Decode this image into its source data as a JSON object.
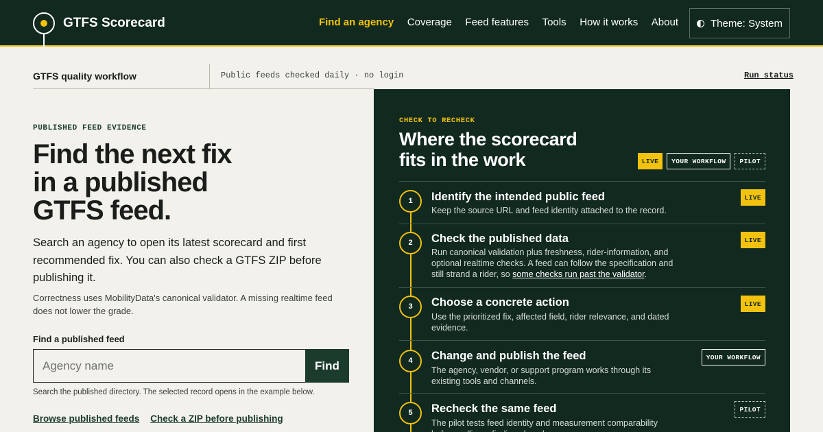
{
  "header": {
    "brand": "GTFS Scorecard",
    "nav": [
      "Find an agency",
      "Coverage",
      "Feed features",
      "Tools",
      "How it works",
      "About"
    ],
    "theme_label": "Theme: System"
  },
  "strip": {
    "title": "GTFS quality workflow",
    "note": "Public feeds checked daily · no login",
    "status_link": "Run status"
  },
  "left": {
    "eyebrow": "PUBLISHED FEED EVIDENCE",
    "hero_lines": [
      "Find the next fix",
      "in a published",
      "GTFS feed."
    ],
    "lede": "Search an agency to open its latest scorecard and first recommended fix. You can also check a GTFS ZIP before publishing it.",
    "note": "Correctness uses MobilityData's canonical validator. A missing realtime feed does not lower the grade.",
    "field_label": "Find a published feed",
    "search_placeholder": "Agency name",
    "search_value": "",
    "find_label": "Find",
    "help": "Search the published directory. The selected record opens in the example below.",
    "links": [
      "Browse published feeds",
      "Check a ZIP before publishing"
    ]
  },
  "panel": {
    "eyebrow": "CHECK TO RECHECK",
    "title_lines": [
      "Where the scorecard",
      "fits in the work"
    ],
    "legend": [
      "LIVE",
      "YOUR WORKFLOW",
      "PILOT"
    ],
    "steps": [
      {
        "num": "1",
        "title": "Identify the intended public feed",
        "desc": "Keep the source URL and feed identity attached to the record.",
        "badge": "LIVE"
      },
      {
        "num": "2",
        "title": "Check the published data",
        "desc": "Run canonical validation plus freshness, rider-information, and optional realtime checks. A feed can follow the specification and still strand a rider, so",
        "desc_link": "some checks run past the validator",
        "desc_end": ".",
        "badge": "LIVE"
      },
      {
        "num": "3",
        "title": "Choose a concrete action",
        "desc": "Use the prioritized fix, affected field, rider relevance, and dated evidence.",
        "badge": "LIVE"
      },
      {
        "num": "4",
        "title": "Change and publish the feed",
        "desc": "The agency, vendor, or support program works through its existing tools and channels.",
        "badge": "YOUR WORKFLOW"
      },
      {
        "num": "5",
        "title": "Recheck the same feed",
        "desc": "The pilot tests feed identity and measurement comparability before calling a finding closed.",
        "badge": "PILOT"
      }
    ]
  },
  "colors": {
    "brand_dark": "#11291f",
    "accent": "#f2c20e",
    "background": "#f2f1ec"
  },
  "icons": {
    "logo": "transit-stop-icon",
    "theme": "half-circle-icon"
  }
}
